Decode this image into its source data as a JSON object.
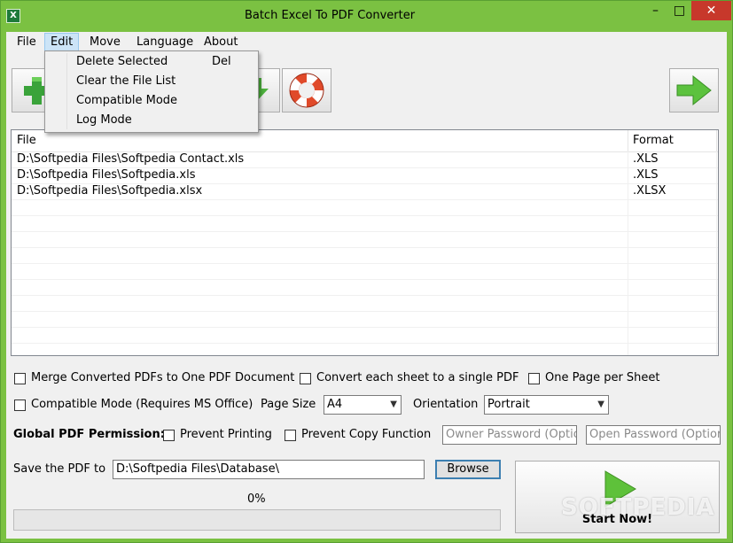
{
  "window": {
    "title": "Batch Excel To PDF Converter",
    "icon_char": "X",
    "minimize": "–",
    "maximize": "□",
    "close": "✕"
  },
  "menu": {
    "file": "File",
    "edit": "Edit",
    "move": "Move",
    "language": "Language",
    "about": "About"
  },
  "edit_menu": {
    "items": [
      {
        "label": "Delete Selected",
        "shortcut": "Del"
      },
      {
        "label": "Clear the File List",
        "shortcut": ""
      },
      {
        "label": "Compatible Mode",
        "shortcut": ""
      },
      {
        "label": "Log Mode",
        "shortcut": ""
      }
    ]
  },
  "toolbar": {
    "icons": [
      "add-icon",
      "move-down-icon",
      "help-lifebuoy-icon",
      "next-arrow-icon"
    ]
  },
  "file_list": {
    "columns": [
      "File",
      "Format"
    ],
    "rows": [
      {
        "file": "D:\\Softpedia Files\\Softpedia Contact.xls",
        "format": ".XLS"
      },
      {
        "file": "D:\\Softpedia Files\\Softpedia.xls",
        "format": ".XLS"
      },
      {
        "file": "D:\\Softpedia Files\\Softpedia.xlsx",
        "format": ".XLSX"
      }
    ]
  },
  "options": {
    "merge": "Merge Converted PDFs to One PDF Document",
    "each_sheet": "Convert each sheet to a single PDF",
    "one_page": "One Page per Sheet",
    "compatible": "Compatible Mode (Requires MS Office)",
    "page_size_label": "Page Size",
    "page_size_value": "A4",
    "orientation_label": "Orientation",
    "orientation_value": "Portrait"
  },
  "permission": {
    "label": "Global PDF Permission:",
    "prevent_printing": "Prevent Printing",
    "prevent_copy": "Prevent Copy Function",
    "owner_password_placeholder": "Owner Password (Optio",
    "open_password_placeholder": "Open Password (Optior"
  },
  "save": {
    "label": "Save the PDF to",
    "path": "D:\\Softpedia Files\\Database\\",
    "browse": "Browse"
  },
  "progress": {
    "text": "0%",
    "value": 0
  },
  "start": {
    "label": "Start Now!",
    "watermark": "SOFTPEDIA"
  },
  "colors": {
    "frame": "#7bc142",
    "close_button": "#c7382b",
    "menu_highlight": "#cce4f7"
  }
}
